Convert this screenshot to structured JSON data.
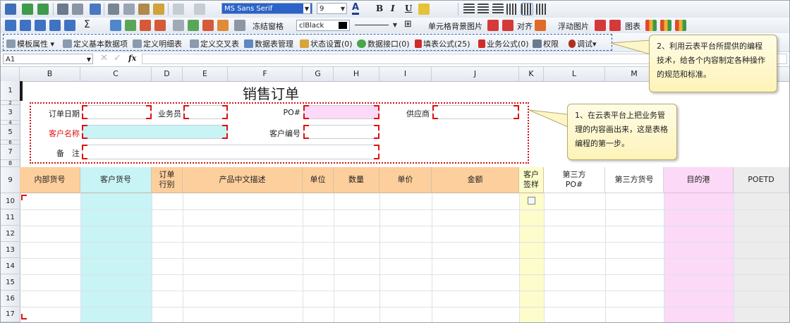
{
  "toolbar1": {
    "font_name": "MS Sans Serif",
    "font_size": "9",
    "bold": "B",
    "italic": "I",
    "underline": "U"
  },
  "toolbar2": {
    "sigma": "Σ",
    "freeze": "冻结窗格",
    "color_name": "clBlack",
    "cell_bg_image": "单元格背景图片",
    "align": "对齐",
    "float_image": "浮动图片",
    "chart": "图表"
  },
  "toolbar3": {
    "items": [
      "模板属性",
      "定义基本数据项",
      "定义明细表",
      "定义交叉表",
      "数据表管理",
      "状态设置(0)",
      "数据接口(0)",
      "填表公式(25)",
      "业务公式(0)",
      "权限",
      "调试"
    ]
  },
  "formula_bar": {
    "cell_ref": "A1",
    "fx": "fx"
  },
  "columns": [
    "B",
    "C",
    "D",
    "E",
    "F",
    "G",
    "H",
    "I",
    "J",
    "K",
    "L",
    "M"
  ],
  "rows": [
    "1",
    "2",
    "3",
    "4",
    "5",
    "6",
    "7",
    "8",
    "9",
    "10",
    "11",
    "12",
    "13",
    "14",
    "15",
    "16",
    "17"
  ],
  "sheet": {
    "title": "销售订单",
    "order_date": "订单日期",
    "salesman": "业务员",
    "po": "PO#",
    "supplier": "供应商",
    "customer_name": "客户名称",
    "customer_no": "客户编号",
    "remark": "备　注"
  },
  "table_headers": [
    "内部货号",
    "客户货号",
    "订单\n行别",
    "产品中文描述",
    "单位",
    "数量",
    "单价",
    "金额",
    "客户\n签样",
    "第三方\nPO#",
    "第三方货号",
    "目的港",
    "POETD"
  ],
  "callouts": {
    "c1": "1、在云表平台上把业务管理的内容画出来，这是表格编程的第一步。",
    "c2": "2、利用云表平台所提供的编程技术，给各个内容制定各种操作的规范和标准。"
  },
  "colors": {
    "header_orange": "#fdcf9c",
    "cyan": "#c8f4f6",
    "pink": "#fbd9f7",
    "yellow": "#fdfccb",
    "red": "#e01010"
  }
}
